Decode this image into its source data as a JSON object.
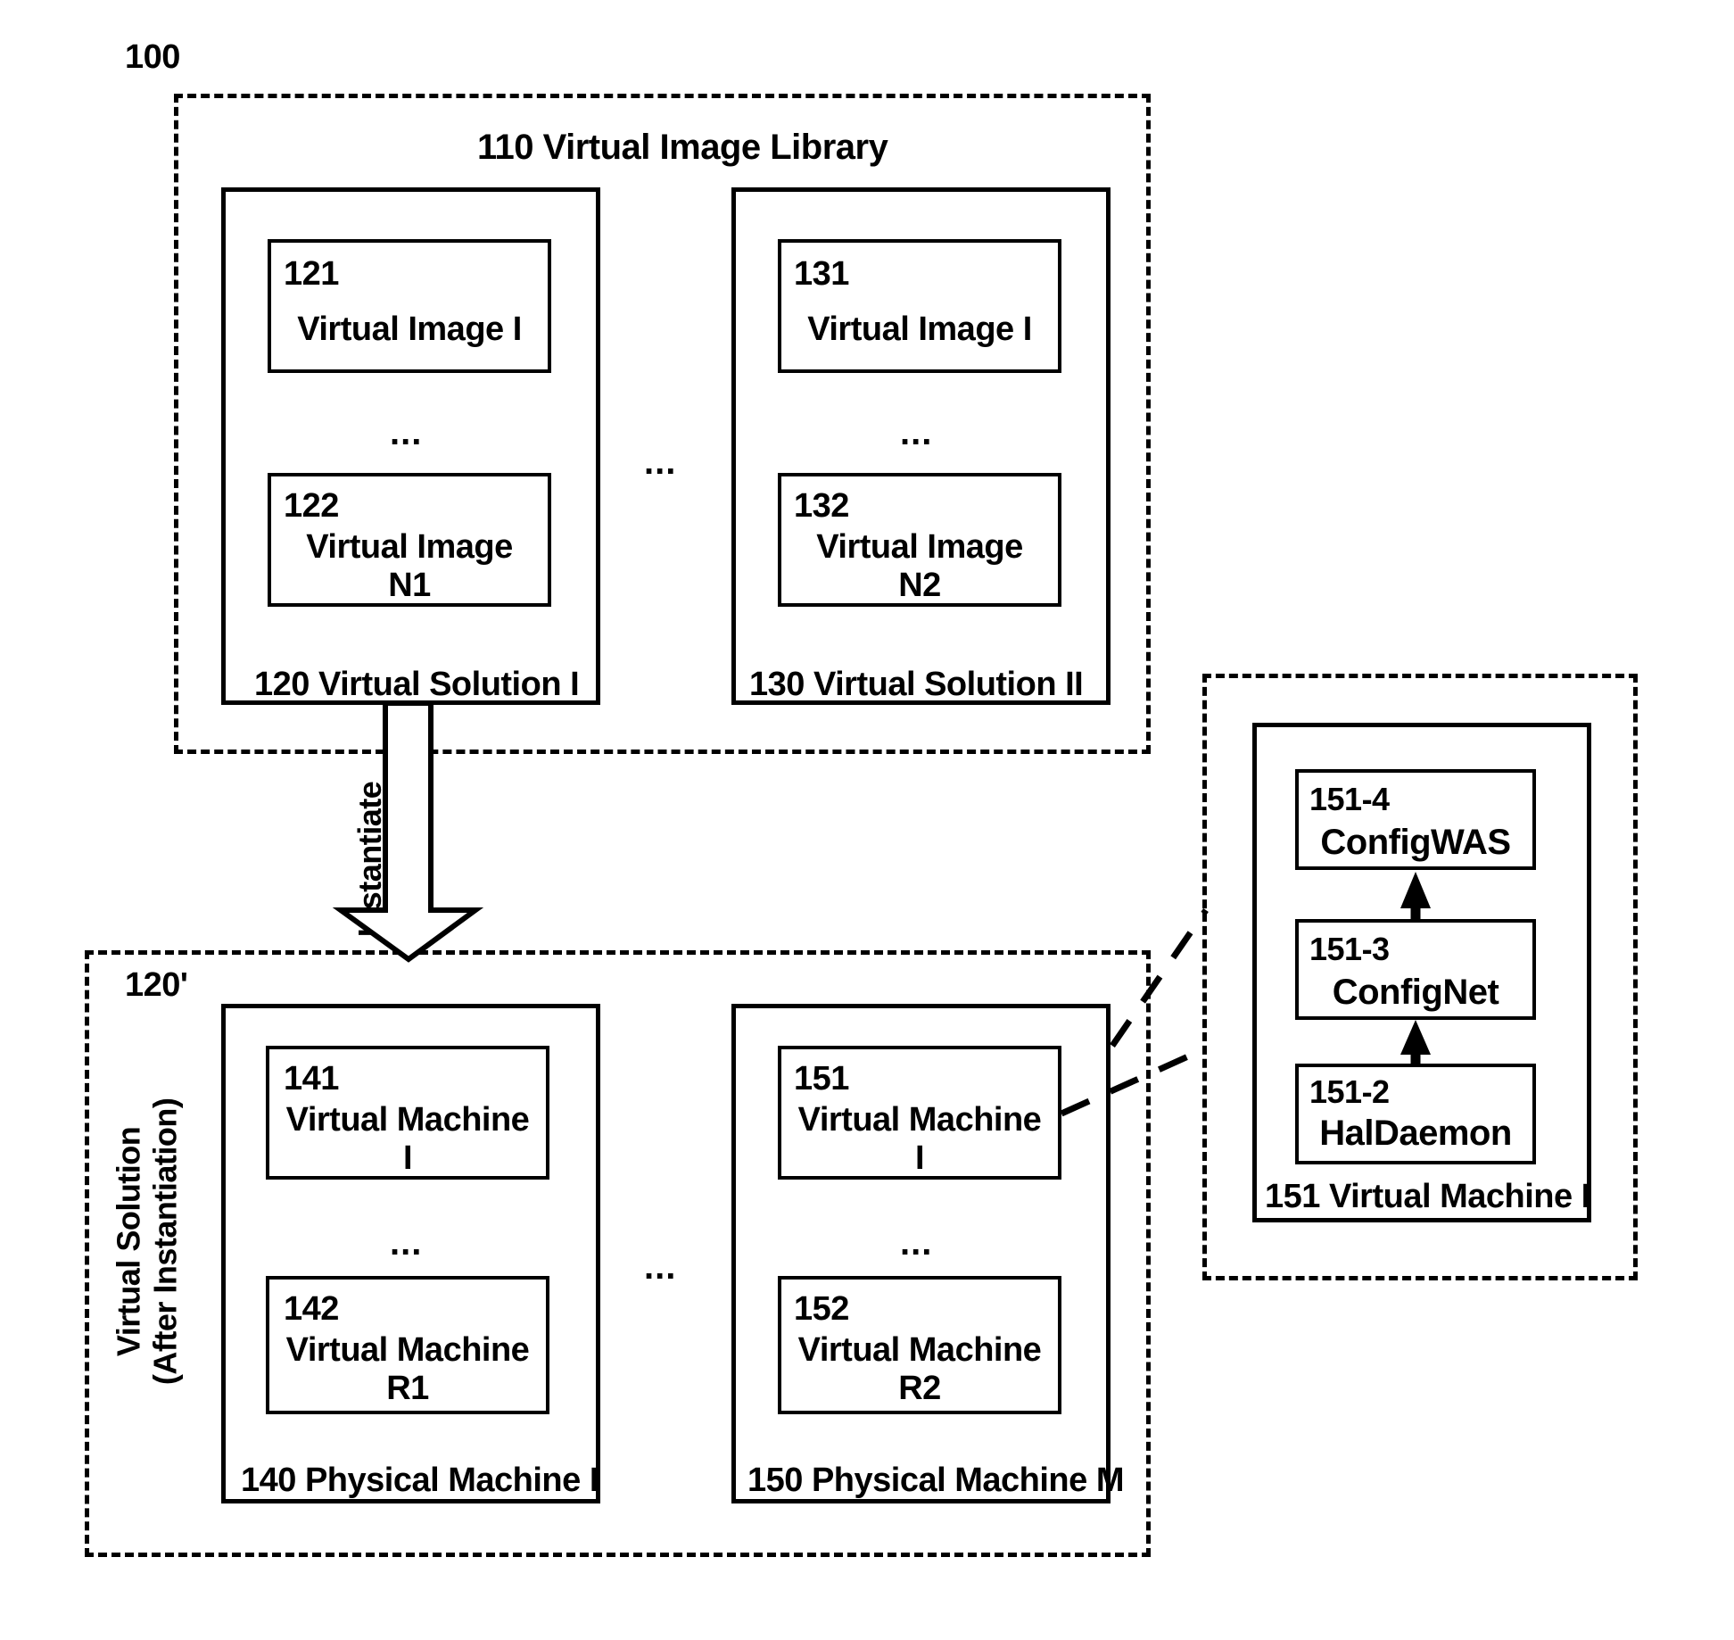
{
  "figure": {
    "root_ref": "100",
    "library": {
      "title": "110 Virtual Image Library",
      "solutions": [
        {
          "label": "120  Virtual Solution I",
          "images": [
            {
              "ref": "121",
              "name": "Virtual Image I"
            },
            {
              "ref": "122",
              "name": "Virtual Image\nN1"
            }
          ],
          "ellipsis": "..."
        },
        {
          "label": "130  Virtual Solution II",
          "images": [
            {
              "ref": "131",
              "name": "Virtual Image I"
            },
            {
              "ref": "132",
              "name": "Virtual Image\nN2"
            }
          ],
          "ellipsis": "..."
        }
      ],
      "between_ellipsis": "..."
    },
    "instantiate_arrow": {
      "label": "Instantiate"
    },
    "runtime": {
      "ref": "120'",
      "side_caption": "Virtual Solution\n(After Instantiation)",
      "machines": [
        {
          "label": "140  Physical Machine I",
          "vms": [
            {
              "ref": "141",
              "name": "Virtual Machine\nI"
            },
            {
              "ref": "142",
              "name": "Virtual Machine\nR1"
            }
          ],
          "ellipsis": "..."
        },
        {
          "label": "150 Physical Machine M",
          "vms": [
            {
              "ref": "151",
              "name": "Virtual Machine\nI"
            },
            {
              "ref": "152",
              "name": "Virtual Machine\nR2"
            }
          ],
          "ellipsis": "..."
        }
      ],
      "between_ellipsis": "..."
    },
    "detail": {
      "vm_label": "151 Virtual Machine I",
      "components": [
        {
          "ref": "151-4",
          "name": "ConfigWAS"
        },
        {
          "ref": "151-3",
          "name": "ConfigNet"
        },
        {
          "ref": "151-2",
          "name": "HalDaemon"
        }
      ]
    }
  }
}
